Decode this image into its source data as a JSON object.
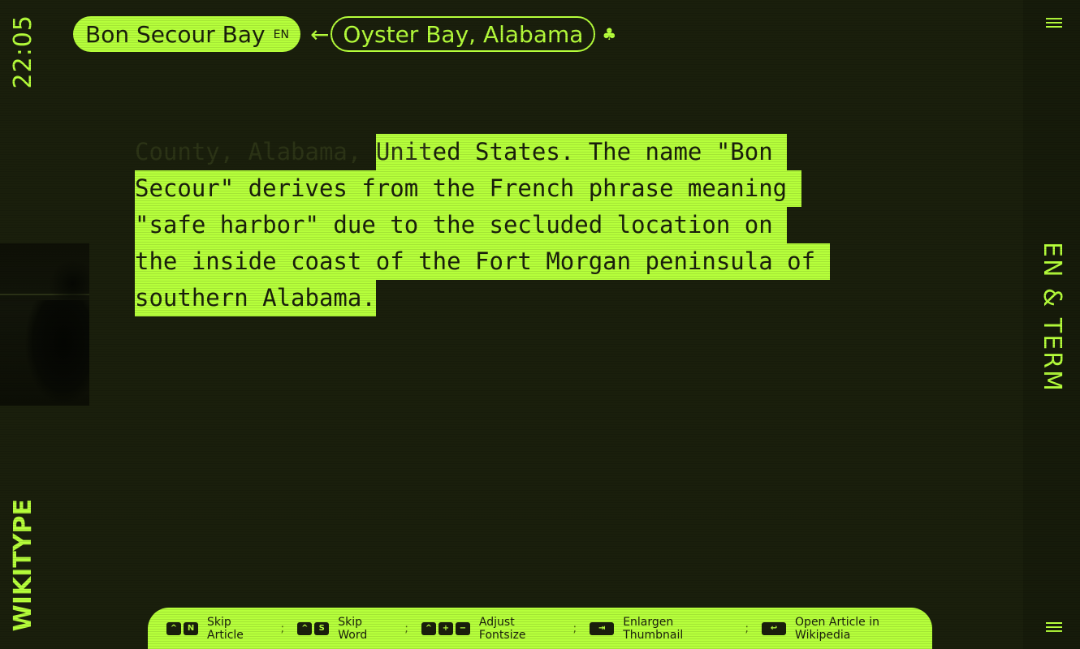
{
  "clock": "22:05",
  "brand": "WIKITYPE",
  "right_rail": {
    "lang_term": "EN & TERM"
  },
  "header": {
    "current_title": "Bon Secour Bay",
    "current_lang": "EN",
    "arrow": "←",
    "next_title": "Oyster Bay, Alabama",
    "clover": "♣"
  },
  "article": {
    "line1_done": "County, Alabama, ",
    "line1_cursor": "Unit",
    "line1_rest": "ed States. The name \"Bon ",
    "line2": "Secour\" derives from the French phrase meaning ",
    "line3": "\"safe harbor\" due to the secluded location on ",
    "line4": "the inside coast of the Fort Morgan peninsula of ",
    "line5": "southern Alabama."
  },
  "footer": {
    "hints": [
      {
        "keys": [
          "^",
          "N"
        ],
        "label": "Skip Article"
      },
      {
        "keys": [
          "^",
          "S"
        ],
        "label": "Skip Word"
      },
      {
        "keys": [
          "^",
          "+",
          "−"
        ],
        "label": "Adjust Fontsize"
      },
      {
        "keys": [
          "⇥"
        ],
        "label": "Enlargen Thumbnail"
      },
      {
        "keys": [
          "↩"
        ],
        "label": "Open Article in Wikipedia"
      }
    ],
    "separator": ";"
  },
  "colors": {
    "accent": "#b6ff3b",
    "background": "#1a1f0c",
    "typed_text": "#2c3416"
  }
}
